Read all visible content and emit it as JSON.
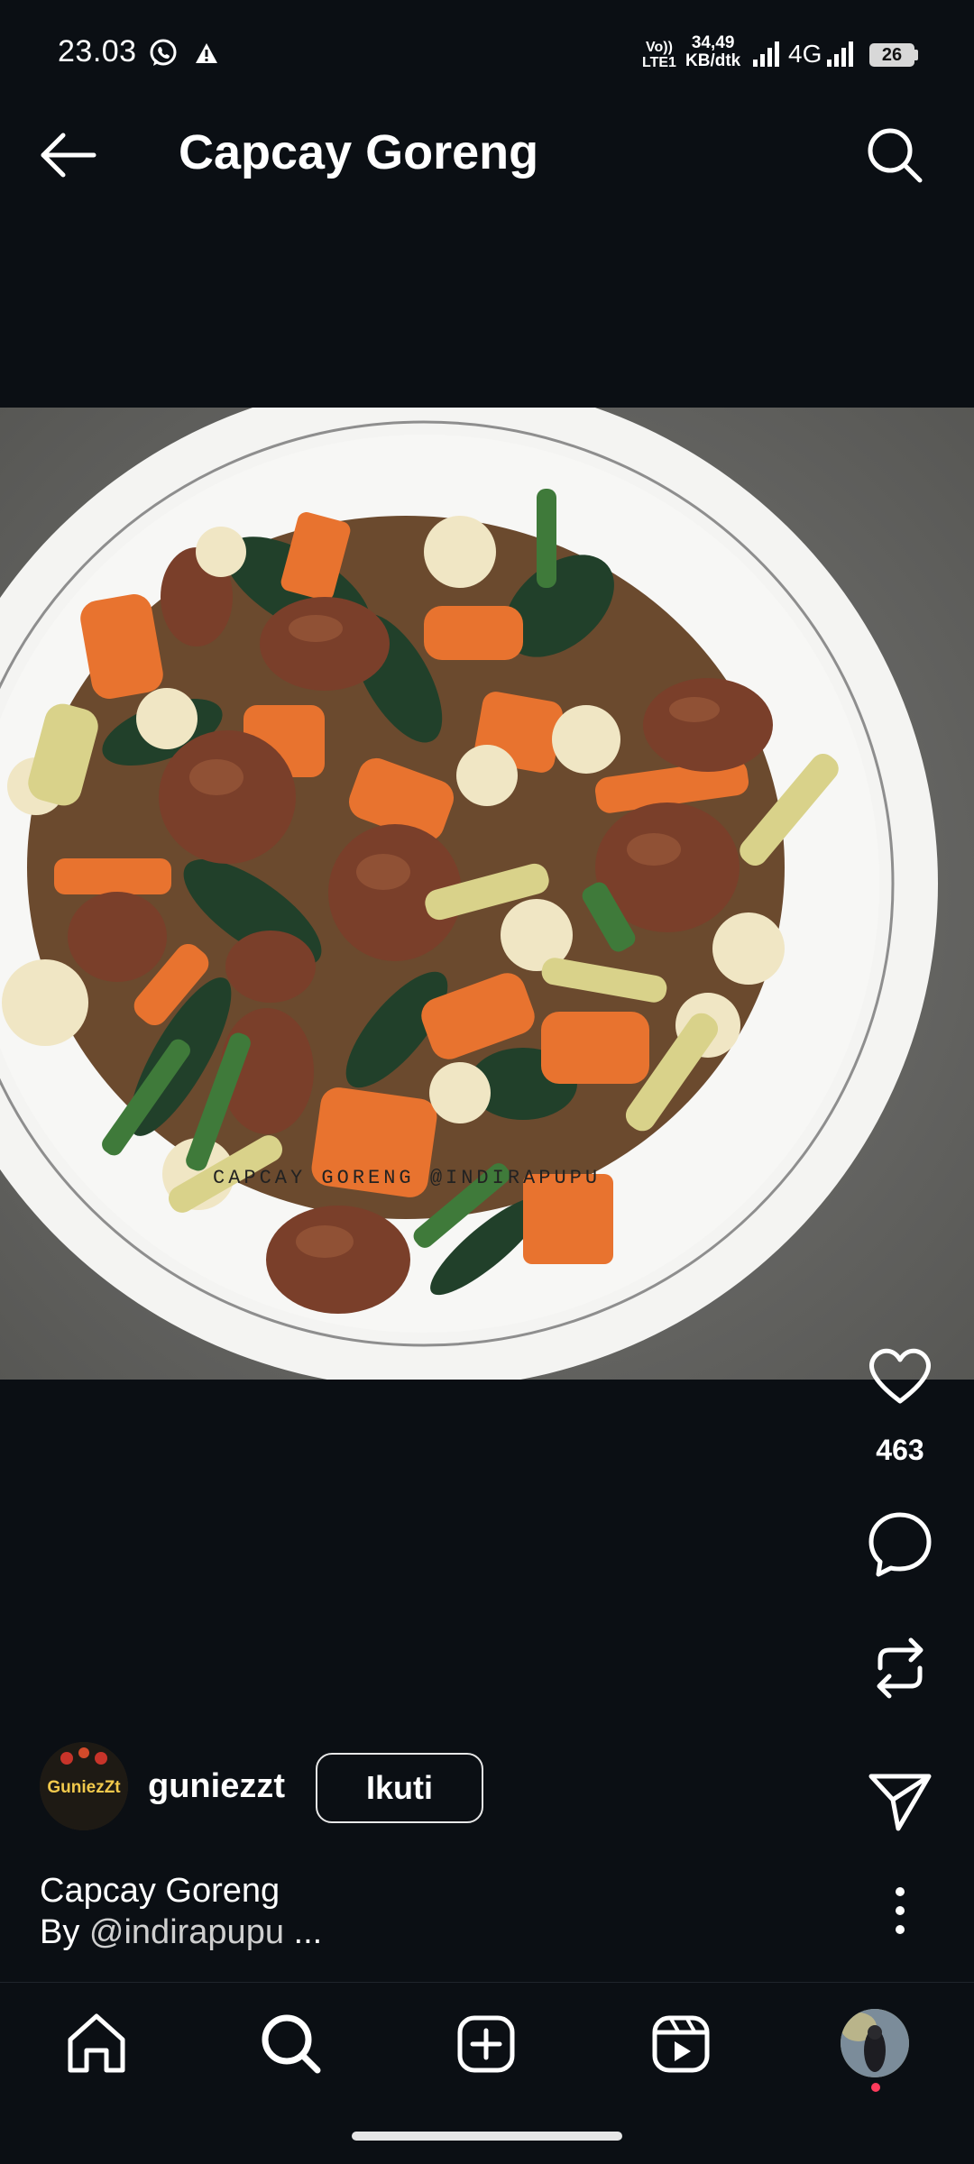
{
  "status_bar": {
    "time": "23.03",
    "volte_line1": "Vo))",
    "volte_line2": "LTE1",
    "speed_value": "34,49",
    "speed_unit": "KB/dtk",
    "network": "4G",
    "battery": "26"
  },
  "header": {
    "title": "Capcay Goreng"
  },
  "photo": {
    "watermark": "CAPCAY GORENG @INDIRAPUPU"
  },
  "actions": {
    "like_count": "463"
  },
  "author": {
    "avatar_text": "GuniezZt",
    "username": "guniezzt",
    "follow_label": "Ikuti"
  },
  "caption": {
    "line1": "Capcay Goreng",
    "line2_prefix": "By ",
    "line2_handle": "@indirapupu",
    "line2_more": " ..."
  },
  "icons": {
    "back": "arrow-left",
    "search": "magnifier",
    "like": "heart-outline",
    "comment": "speech-bubble",
    "remix": "repeat-arrows",
    "send": "paper-plane",
    "more": "vertical-dots",
    "nav": [
      "home",
      "search",
      "plus-square",
      "reels",
      "profile-avatar"
    ]
  }
}
